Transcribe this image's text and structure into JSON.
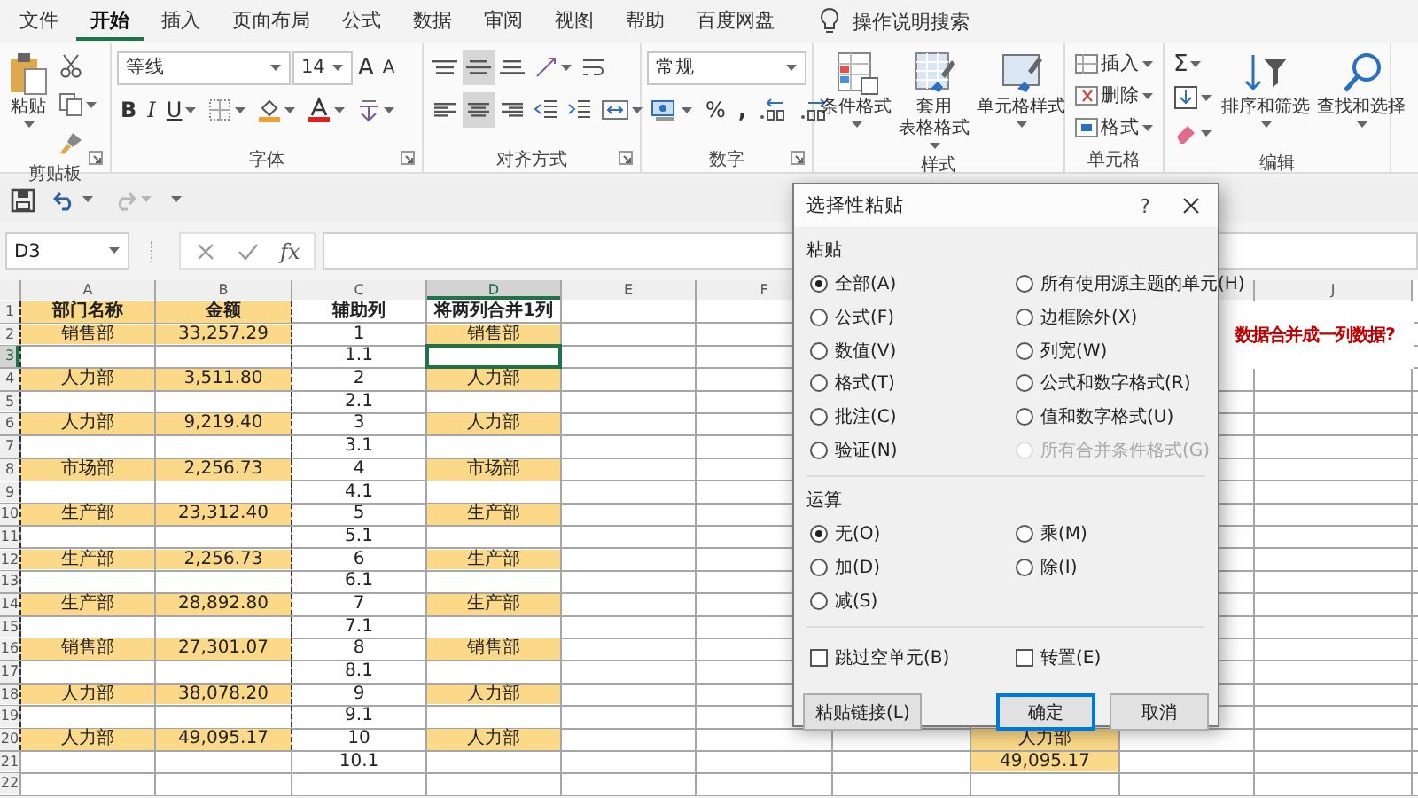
{
  "tabs": [
    {
      "label": "文件",
      "selected": false
    },
    {
      "label": "开始",
      "selected": true
    },
    {
      "label": "插入",
      "selected": false
    },
    {
      "label": "页面布局",
      "selected": false
    },
    {
      "label": "公式",
      "selected": false
    },
    {
      "label": "数据",
      "selected": false
    },
    {
      "label": "审阅",
      "selected": false
    },
    {
      "label": "视图",
      "selected": false
    },
    {
      "label": "帮助",
      "selected": false
    },
    {
      "label": "百度网盘",
      "selected": false
    }
  ],
  "tell_me": "操作说明搜索",
  "ribbon": [
    {
      "kind": "clipboard",
      "label": "剪贴板",
      "launcher": true,
      "paste": "粘贴"
    },
    {
      "kind": "font",
      "label": "字体",
      "launcher": true,
      "font": "等线",
      "size": "14",
      "grow": "A",
      "shrink": "A",
      "bold": "B",
      "italic": "I",
      "underline": "U"
    },
    {
      "kind": "alignment",
      "label": "对齐方式",
      "launcher": true,
      "vertical": [
        {
          "selected": false
        },
        {
          "selected": true
        },
        {
          "selected": false
        }
      ],
      "horizontal": [
        {
          "selected": false
        },
        {
          "selected": true
        },
        {
          "selected": false
        }
      ]
    },
    {
      "kind": "number",
      "label": "数字",
      "launcher": true,
      "format": "常规",
      "percent": "%",
      "comma": ","
    },
    {
      "kind": "styles",
      "label": "样式",
      "launcher": false,
      "buttons": [
        {
          "lines": [
            "条件格式"
          ]
        },
        {
          "lines": [
            "套用",
            "表格格式"
          ]
        },
        {
          "lines": [
            "单元格样式"
          ]
        }
      ]
    },
    {
      "kind": "cells",
      "label": "单元格",
      "launcher": false,
      "buttons": [
        "插入",
        "删除",
        "格式"
      ]
    },
    {
      "kind": "editing",
      "label": "编辑",
      "launcher": false,
      "sum": "Σ",
      "buttons": [
        "排序和筛选",
        "查找和选择"
      ]
    }
  ],
  "quick_access": {
    "redo_disabled": true
  },
  "formula_bar": {
    "name_box": "D3",
    "fx": "fx"
  },
  "columns": [
    {
      "label": "A",
      "selected": false
    },
    {
      "label": "B",
      "selected": false
    },
    {
      "label": "C",
      "selected": false
    },
    {
      "label": "D",
      "selected": true
    },
    {
      "label": "E",
      "selected": false
    },
    {
      "label": "F",
      "selected": false
    }
  ],
  "right_columns": [
    {
      "selected": false
    },
    {
      "label": "J",
      "selected": false
    }
  ],
  "rows": [
    {
      "label": "1",
      "kind": "header",
      "selected": false,
      "copied": true,
      "cells": {
        "a": {
          "text": "部门名称",
          "filled": true
        },
        "b": {
          "text": "金额",
          "filled": true
        },
        "c": {
          "text": "辅助列",
          "filled": false
        },
        "d": {
          "text": "将两列合并1列",
          "filled": false
        }
      }
    },
    {
      "label": "2",
      "kind": "data",
      "selected": false,
      "copied": true,
      "cells": {
        "a": {
          "text": "销售部",
          "filled": true
        },
        "b": {
          "text": "33,257.29",
          "filled": true
        },
        "c": {
          "text": "1",
          "filled": false
        },
        "d": {
          "text": "销售部",
          "filled": true
        }
      }
    },
    {
      "label": "3",
      "kind": "data",
      "selected": true,
      "copied": true,
      "cells": {
        "c": {
          "text": "1.1",
          "filled": false
        }
      }
    },
    {
      "label": "4",
      "kind": "data",
      "selected": false,
      "copied": true,
      "cells": {
        "a": {
          "text": "人力部",
          "filled": true
        },
        "b": {
          "text": "3,511.80",
          "filled": true
        },
        "c": {
          "text": "2",
          "filled": false
        },
        "d": {
          "text": "人力部",
          "filled": true
        }
      }
    },
    {
      "label": "5",
      "kind": "data",
      "selected": false,
      "copied": true,
      "cells": {
        "c": {
          "text": "2.1",
          "filled": false
        }
      }
    },
    {
      "label": "6",
      "kind": "data",
      "selected": false,
      "copied": true,
      "cells": {
        "a": {
          "text": "人力部",
          "filled": true
        },
        "b": {
          "text": "9,219.40",
          "filled": true
        },
        "c": {
          "text": "3",
          "filled": false
        },
        "d": {
          "text": "人力部",
          "filled": true
        }
      }
    },
    {
      "label": "7",
      "kind": "data",
      "selected": false,
      "copied": true,
      "cells": {
        "c": {
          "text": "3.1",
          "filled": false
        }
      }
    },
    {
      "label": "8",
      "kind": "data",
      "selected": false,
      "copied": true,
      "cells": {
        "a": {
          "text": "市场部",
          "filled": true
        },
        "b": {
          "text": "2,256.73",
          "filled": true
        },
        "c": {
          "text": "4",
          "filled": false
        },
        "d": {
          "text": "市场部",
          "filled": true
        }
      }
    },
    {
      "label": "9",
      "kind": "data",
      "selected": false,
      "copied": true,
      "cells": {
        "c": {
          "text": "4.1",
          "filled": false
        }
      }
    },
    {
      "label": "10",
      "kind": "data",
      "selected": false,
      "copied": true,
      "cells": {
        "a": {
          "text": "生产部",
          "filled": true
        },
        "b": {
          "text": "23,312.40",
          "filled": true
        },
        "c": {
          "text": "5",
          "filled": false
        },
        "d": {
          "text": "生产部",
          "filled": true
        }
      }
    },
    {
      "label": "11",
      "kind": "data",
      "selected": false,
      "copied": true,
      "cells": {
        "c": {
          "text": "5.1",
          "filled": false
        }
      }
    },
    {
      "label": "12",
      "kind": "data",
      "selected": false,
      "copied": true,
      "cells": {
        "a": {
          "text": "生产部",
          "filled": true
        },
        "b": {
          "text": "2,256.73",
          "filled": true
        },
        "c": {
          "text": "6",
          "filled": false
        },
        "d": {
          "text": "生产部",
          "filled": true
        }
      }
    },
    {
      "label": "13",
      "kind": "data",
      "selected": false,
      "copied": true,
      "cells": {
        "c": {
          "text": "6.1",
          "filled": false
        }
      }
    },
    {
      "label": "14",
      "kind": "data",
      "selected": false,
      "copied": true,
      "cells": {
        "a": {
          "text": "生产部",
          "filled": true
        },
        "b": {
          "text": "28,892.80",
          "filled": true
        },
        "c": {
          "text": "7",
          "filled": false
        },
        "d": {
          "text": "生产部",
          "filled": true
        }
      }
    },
    {
      "label": "15",
      "kind": "data",
      "selected": false,
      "copied": true,
      "cells": {
        "c": {
          "text": "7.1",
          "filled": false
        }
      }
    },
    {
      "label": "16",
      "kind": "data",
      "selected": false,
      "copied": true,
      "cells": {
        "a": {
          "text": "销售部",
          "filled": true
        },
        "b": {
          "text": "27,301.07",
          "filled": true
        },
        "c": {
          "text": "8",
          "filled": false
        },
        "d": {
          "text": "销售部",
          "filled": true
        }
      }
    },
    {
      "label": "17",
      "kind": "data",
      "selected": false,
      "copied": true,
      "cells": {
        "c": {
          "text": "8.1",
          "filled": false
        }
      }
    },
    {
      "label": "18",
      "kind": "data",
      "selected": false,
      "copied": true,
      "cells": {
        "a": {
          "text": "人力部",
          "filled": true
        },
        "b": {
          "text": "38,078.20",
          "filled": true
        },
        "c": {
          "text": "9",
          "filled": false
        },
        "d": {
          "text": "人力部",
          "filled": true
        }
      }
    },
    {
      "label": "19",
      "kind": "data",
      "selected": false,
      "copied": true,
      "cells": {
        "c": {
          "text": "9.1",
          "filled": false
        }
      }
    },
    {
      "label": "20",
      "kind": "data",
      "selected": false,
      "copied": true,
      "cells": {
        "a": {
          "text": "人力部",
          "filled": true
        },
        "b": {
          "text": "49,095.17",
          "filled": true
        },
        "c": {
          "text": "10",
          "filled": false
        },
        "d": {
          "text": "人力部",
          "filled": true
        },
        "h": {
          "text": "人力部",
          "filled": true
        }
      }
    },
    {
      "label": "21",
      "kind": "data",
      "selected": false,
      "copied": false,
      "cells": {
        "c": {
          "text": "10.1",
          "filled": false
        },
        "h": {
          "text": "49,095.17",
          "filled": true
        }
      }
    },
    {
      "label": "22",
      "kind": "data",
      "selected": false,
      "copied": false
    }
  ],
  "note": "数据合并成一列数据?",
  "dialog": {
    "title": "选择性粘贴",
    "help": "?",
    "paste_label": "粘贴",
    "paste_options": [
      {
        "label": "全部(A)",
        "selected": true,
        "disabled": false
      },
      {
        "label": "所有使用源主题的单元(H)",
        "selected": false,
        "disabled": false
      },
      {
        "label": "公式(F)",
        "selected": false,
        "disabled": false
      },
      {
        "label": "边框除外(X)",
        "selected": false,
        "disabled": false
      },
      {
        "label": "数值(V)",
        "selected": false,
        "disabled": false
      },
      {
        "label": "列宽(W)",
        "selected": false,
        "disabled": false
      },
      {
        "label": "格式(T)",
        "selected": false,
        "disabled": false
      },
      {
        "label": "公式和数字格式(R)",
        "selected": false,
        "disabled": false
      },
      {
        "label": "批注(C)",
        "selected": false,
        "disabled": false
      },
      {
        "label": "值和数字格式(U)",
        "selected": false,
        "disabled": false
      },
      {
        "label": "验证(N)",
        "selected": false,
        "disabled": false
      },
      {
        "label": "所有合并条件格式(G)",
        "selected": false,
        "disabled": true
      }
    ],
    "operation_label": "运算",
    "operations": [
      {
        "label": "无(O)",
        "selected": true
      },
      {
        "label": "乘(M)",
        "selected": false
      },
      {
        "label": "加(D)",
        "selected": false
      },
      {
        "label": "除(I)",
        "selected": false
      },
      {
        "label": "减(S)",
        "selected": false
      }
    ],
    "checkboxes": [
      {
        "label": "跳过空单元(B)",
        "checked": false
      },
      {
        "label": "转置(E)",
        "checked": false
      }
    ],
    "buttons": [
      {
        "label": "粘贴链接(L)",
        "default": false
      },
      {
        "label": "确定",
        "default": true
      },
      {
        "label": "取消",
        "default": false
      }
    ]
  }
}
